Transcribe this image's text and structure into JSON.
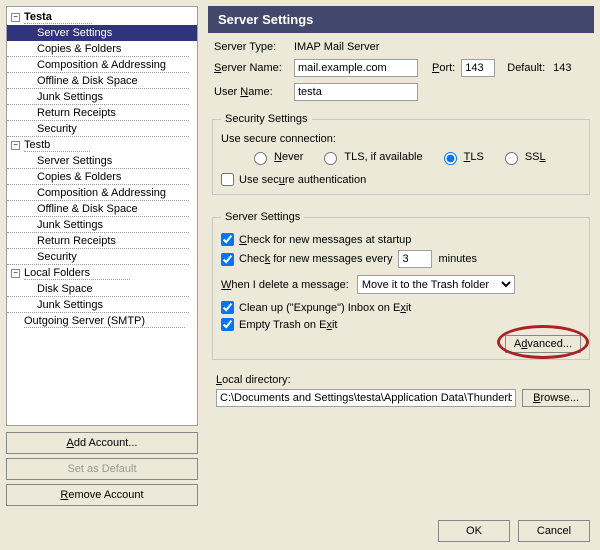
{
  "sidebar": {
    "accounts": [
      {
        "name": "Testa",
        "expanded": true,
        "bold": true,
        "children": [
          {
            "label": "Server Settings",
            "selected": true
          },
          {
            "label": "Copies & Folders"
          },
          {
            "label": "Composition & Addressing"
          },
          {
            "label": "Offline & Disk Space"
          },
          {
            "label": "Junk Settings"
          },
          {
            "label": "Return Receipts"
          },
          {
            "label": "Security"
          }
        ]
      },
      {
        "name": "Testb",
        "expanded": true,
        "children": [
          {
            "label": "Server Settings"
          },
          {
            "label": "Copies & Folders"
          },
          {
            "label": "Composition & Addressing"
          },
          {
            "label": "Offline & Disk Space"
          },
          {
            "label": "Junk Settings"
          },
          {
            "label": "Return Receipts"
          },
          {
            "label": "Security"
          }
        ]
      },
      {
        "name": "Local Folders",
        "expanded": true,
        "children": [
          {
            "label": "Disk Space"
          },
          {
            "label": "Junk Settings"
          }
        ]
      }
    ],
    "outgoing_label": "Outgoing Server (SMTP)",
    "buttons": {
      "add": "Add Account...",
      "set_default": "Set as Default",
      "remove": "Remove Account"
    }
  },
  "content": {
    "title": "Server Settings",
    "server_type_label": "Server Type:",
    "server_type_value": "IMAP Mail Server",
    "server_name_label": "Server Name:",
    "server_name_value": "mail.example.com",
    "port_label": "Port:",
    "port_value": "143",
    "default_label": "Default:",
    "default_value": "143",
    "user_name_label": "User Name:",
    "user_name_value": "testa",
    "security": {
      "legend": "Security Settings",
      "secure_conn_label": "Use secure connection:",
      "options": {
        "never": "Never",
        "tls_if": "TLS, if available",
        "tls": "TLS",
        "ssl": "SSL"
      },
      "selected": "tls",
      "secure_auth_label": "Use secure authentication",
      "secure_auth_checked": false
    },
    "server": {
      "legend": "Server Settings",
      "check_startup": "Check for new messages at startup",
      "check_startup_checked": true,
      "check_every_prefix": "Check for new messages every",
      "check_every_value": "3",
      "check_every_suffix": "minutes",
      "check_every_checked": true,
      "delete_label": "When I delete a message:",
      "delete_value": "Move it to the Trash folder",
      "cleanup": "Clean up (\"Expunge\") Inbox on Exit",
      "cleanup_checked": true,
      "empty_trash": "Empty Trash on Exit",
      "empty_trash_checked": true,
      "advanced_button": "Advanced..."
    },
    "local_directory": {
      "label": "Local directory:",
      "value": "C:\\Documents and Settings\\testa\\Application Data\\Thunderbird\\",
      "browse": "Browse..."
    }
  },
  "dialog_buttons": {
    "ok": "OK",
    "cancel": "Cancel"
  }
}
